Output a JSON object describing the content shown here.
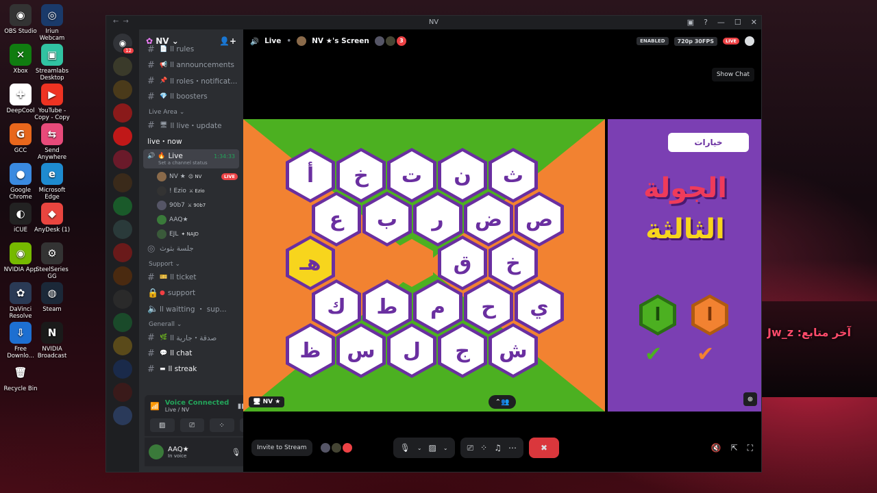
{
  "desktop": {
    "icons": [
      {
        "label": "OBS Studio",
        "color": "#333",
        "glyph": "◉"
      },
      {
        "label": "Iriun Webcam",
        "color": "#1a3a6a",
        "glyph": "◎"
      },
      {
        "label": "Xbox",
        "color": "#107c10",
        "glyph": "✕"
      },
      {
        "label": "Streamlabs Desktop",
        "color": "#31c3a2",
        "glyph": "▣"
      },
      {
        "label": "DeepCool",
        "color": "#fff",
        "glyph": "✚"
      },
      {
        "label": "YouTube - Copy - Copy",
        "color": "#e32",
        "glyph": "▶"
      },
      {
        "label": "GCC",
        "color": "#e8671c",
        "glyph": "G"
      },
      {
        "label": "Send Anywhere",
        "color": "#e84a7a",
        "glyph": "⇆"
      },
      {
        "label": "Google Chrome",
        "color": "#3a8ae0",
        "glyph": "●"
      },
      {
        "label": "Microsoft Edge",
        "color": "#1e8bd0",
        "glyph": "e"
      },
      {
        "label": "iCUE",
        "color": "#222",
        "glyph": "◐"
      },
      {
        "label": "AnyDesk (1)",
        "color": "#e9453f",
        "glyph": "◆"
      },
      {
        "label": "NVIDIA App",
        "color": "#76b900",
        "glyph": "◉"
      },
      {
        "label": "SteelSeries GG",
        "color": "#333",
        "glyph": "⚙"
      },
      {
        "label": "DaVinci Resolve",
        "color": "#2a3a55",
        "glyph": "✿"
      },
      {
        "label": "Steam",
        "color": "#1b2838",
        "glyph": "◍"
      },
      {
        "label": "Free Downlo...",
        "color": "#1d6fd1",
        "glyph": "⇩"
      },
      {
        "label": "NVIDIA Broadcast",
        "color": "#1a1a1a",
        "glyph": "N"
      },
      {
        "label": "Recycle Bin",
        "color": "transparent",
        "glyph": "🗑"
      }
    ],
    "watermark": "Jw_z :آخر متابع"
  },
  "window": {
    "title": "NV",
    "badge_count": "12"
  },
  "guild": {
    "name": "NV"
  },
  "channels": {
    "top": [
      {
        "icon": "📄",
        "label": "ll rules"
      },
      {
        "icon": "📢",
        "label": "ll announcements"
      },
      {
        "icon": "📌",
        "label": "ll roles・notificat..."
      },
      {
        "icon": "💎",
        "label": "ll boosters"
      }
    ],
    "cat_live": "Live Area",
    "live_update": "ll live・update",
    "live_now": "live・now",
    "voice_live": "Live",
    "voice_time": "1:34:33",
    "voice_status": "Set a channel status",
    "voice_users": [
      {
        "name": "NV ★",
        "tag": "😐 NV",
        "live": "LIVE"
      },
      {
        "name": "! Ezio",
        "tag": "⚔ Ezio"
      },
      {
        "name": "90b7",
        "tag": "⚔ 90b7"
      },
      {
        "name": "AAQ★",
        "tag": ""
      },
      {
        "name": "EJL",
        "tag": "✦ NAJD"
      }
    ],
    "stage": "جلسة بثوث",
    "cat_support": "Support",
    "ticket": "ll ticket",
    "support": "support",
    "waiting": "ll waitting ・ sup...",
    "cat_general": "Generall",
    "sadaqa": "ll صدقة・جارية",
    "chat": "ll chat",
    "streak": "ll streak"
  },
  "voice_panel": {
    "status": "Voice Connected",
    "sub": "Live / NV"
  },
  "user_panel": {
    "name": "AAQ★",
    "status": "In voice"
  },
  "call": {
    "channel": "Live",
    "screen": "NV ★'s Screen",
    "viewers": "3",
    "enabled": "ENABLED",
    "quality": "720p 30FPS",
    "live": "LIVE",
    "tooltip": "Show Chat",
    "stream_label": "NV ★",
    "invite": "Invite to Stream"
  },
  "game": {
    "rows": [
      [
        "أ",
        "خ",
        "ت",
        "ن",
        "ث"
      ],
      [
        "ع",
        "ب",
        "ر",
        "ض",
        "ص"
      ],
      [
        "هـ",
        "",
        "",
        "ق",
        "خ"
      ],
      [
        "ك",
        "ط",
        "م",
        "ح",
        "ي"
      ],
      [
        "ظ",
        "س",
        "ل",
        "ج",
        "ش"
      ]
    ],
    "yellow": "هـ",
    "options_btn": "خيارات",
    "round_line1": "الجولة",
    "round_line2": "الثالثة",
    "score_green": "ا",
    "score_orange": "ا",
    "colors": {
      "green": "#4cb021",
      "orange": "#f28231",
      "purple": "#7b3fb3",
      "yellow": "#f7d51d"
    }
  }
}
